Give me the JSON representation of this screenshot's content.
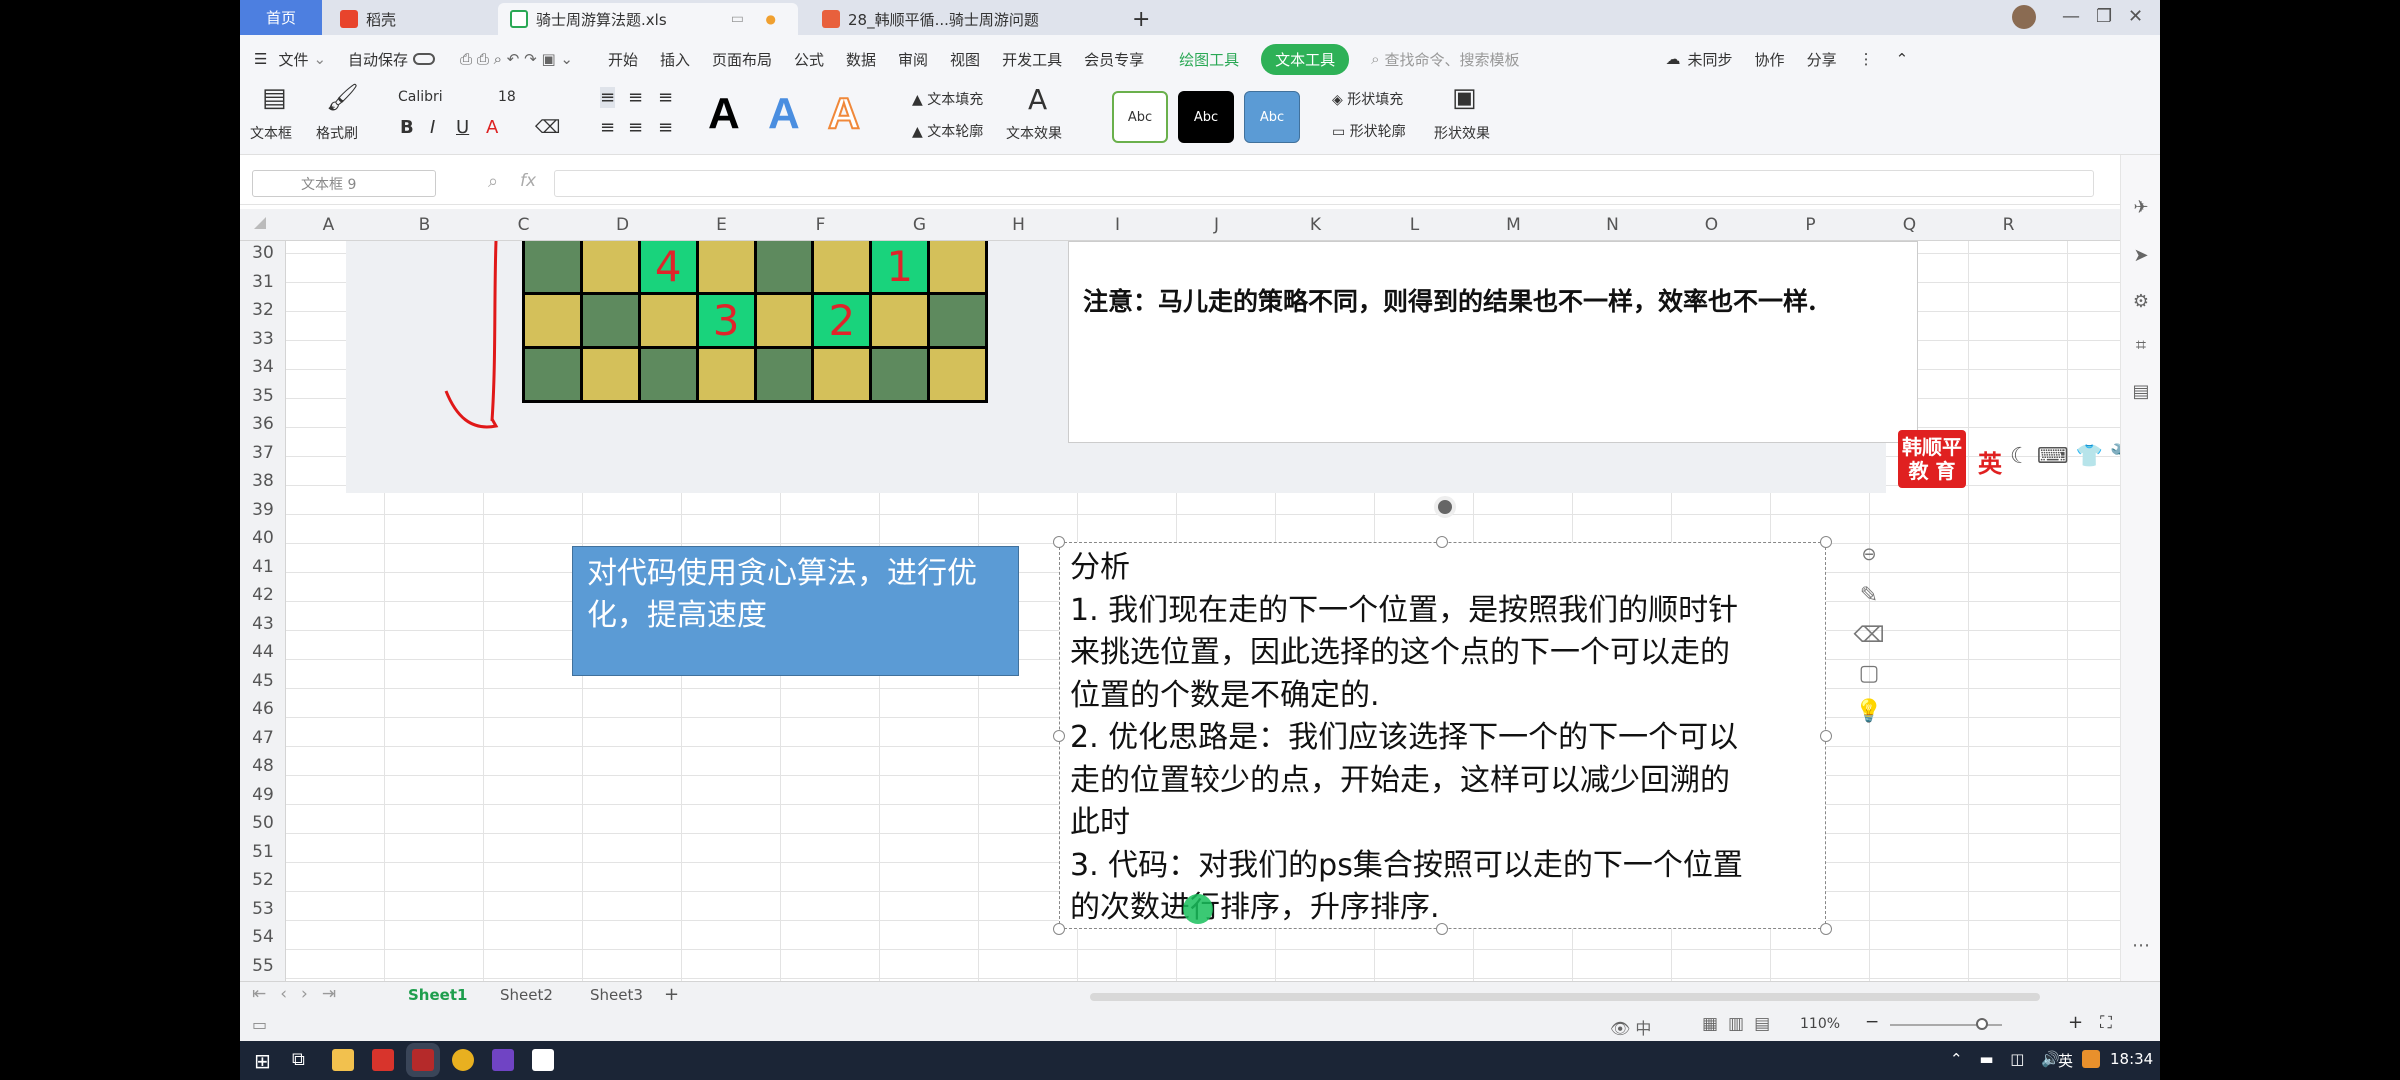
{
  "tabs": {
    "home": "首页",
    "t1": "稻壳",
    "t2": "骑士周游算法题.xls",
    "t3": "28_韩顺平循...骑士周游问题",
    "add": "+"
  },
  "menu": {
    "file": "文件",
    "autosave": "自动保存",
    "items": [
      "开始",
      "插入",
      "页面布局",
      "公式",
      "数据",
      "审阅",
      "视图",
      "开发工具",
      "会员专享"
    ],
    "draw_tools": "绘图工具",
    "text_tools": "文本工具",
    "search": "查找命令、搜索模板",
    "unsync": "未同步",
    "collab": "协作",
    "share": "分享"
  },
  "ribbon": {
    "textbox": "文本框",
    "format_painter": "格式刷",
    "font": "Calibri",
    "size": "18",
    "fill": "文本填充",
    "outline": "文本轮廓",
    "effect": "文本效果",
    "abc": "Abc",
    "shape_fill": "形状填充",
    "shape_outline": "形状轮廓",
    "shape_effect": "形状效果"
  },
  "formula": {
    "name_box": "文本框 9",
    "fx": "fx"
  },
  "columns": [
    "A",
    "B",
    "C",
    "D",
    "E",
    "F",
    "G",
    "H",
    "I",
    "J",
    "K",
    "L",
    "M",
    "N",
    "O",
    "P",
    "Q",
    "R"
  ],
  "rows": [
    "30",
    "31",
    "32",
    "33",
    "34",
    "35",
    "36",
    "37",
    "38",
    "39",
    "40",
    "41",
    "42",
    "43",
    "44",
    "45",
    "46",
    "47",
    "48",
    "49",
    "50",
    "51",
    "52",
    "53",
    "54",
    "55"
  ],
  "board": {
    "n4": "4",
    "n1": "1",
    "n3": "3",
    "n2": "2"
  },
  "note": "注意：马儿走的策略不同，则得到的结果也不一样，效率也不一样.",
  "blue_box": "对代码使用贪心算法，进行优化，提高速度",
  "analysis": {
    "title": "分析",
    "l1": "1. 我们现在走的下一个位置，是按照我们的顺时针",
    "l2": "来挑选位置，因此选择的这个点的下一个可以走的",
    "l3": "位置的个数是不确定的.",
    "l4": "2. 优化思路是：我们应该选择下一个的下一个可以",
    "l5": "走的位置较少的点，开始走，这样可以减少回溯的",
    "l6": "此时",
    "l7": "3. 代码：对我们的ps集合按照可以走的下一个位置",
    "l8": "的次数进行排序，升序排序."
  },
  "ime": {
    "logo": "韩顺平教 育",
    "lang": "英"
  },
  "sheets": [
    "Sheet1",
    "Sheet2",
    "Sheet3"
  ],
  "status": {
    "zoom": "110%"
  },
  "taskbar": {
    "lang": "英",
    "time": "18:34"
  },
  "colors": {
    "accent": "#2eb157",
    "home_tab": "#4d7fe0",
    "blue_box": "#5b9bd5"
  }
}
